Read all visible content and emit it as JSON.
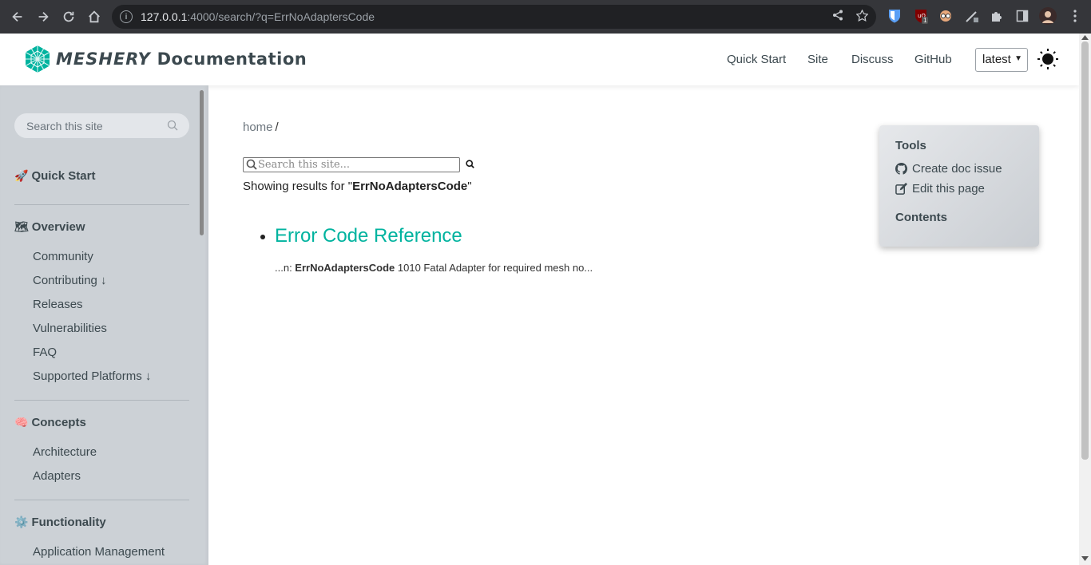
{
  "browser": {
    "url_host": "127.0.0.1",
    "url_rest": ":4000/search/?q=ErrNoAdaptersCode",
    "extension_badge": "1"
  },
  "header": {
    "brand_word": "MESHERY",
    "brand_rest": "Documentation",
    "nav": [
      "Quick Start",
      "Site",
      "Discuss",
      "GitHub"
    ],
    "version": "latest"
  },
  "sidebar": {
    "search_placeholder": "Search this site",
    "sections": [
      {
        "emoji": "🚀",
        "label": "Quick Start",
        "items": []
      },
      {
        "emoji": "🗺",
        "label": "Overview",
        "items": [
          "Community",
          "Contributing ↓",
          "Releases",
          "Vulnerabilities",
          "FAQ",
          "Supported Platforms ↓"
        ]
      },
      {
        "emoji": "🧠",
        "label": "Concepts",
        "items": [
          "Architecture",
          "Adapters"
        ]
      },
      {
        "emoji": "⚙️",
        "label": "Functionality",
        "items": [
          "Application Management"
        ]
      }
    ]
  },
  "main": {
    "breadcrumb_home": "home",
    "breadcrumb_sep": "/",
    "search_placeholder": "Search this site...",
    "showing_prefix": "Showing results for \"",
    "query": "ErrNoAdaptersCode",
    "showing_suffix": "\"",
    "results": [
      {
        "title": "Error Code Reference",
        "snippet_prefix": "...n: ",
        "snippet_match": "ErrNoAdaptersCode",
        "snippet_rest": " 1010 Fatal Adapter for required mesh no..."
      }
    ]
  },
  "toc": {
    "tools_heading": "Tools",
    "create_issue": "Create doc issue",
    "edit_page": "Edit this page",
    "contents_heading": "Contents"
  },
  "colors": {
    "accent": "#00b39f",
    "sidebar_bg": "#ccd1d6",
    "text": "#3c494f"
  }
}
